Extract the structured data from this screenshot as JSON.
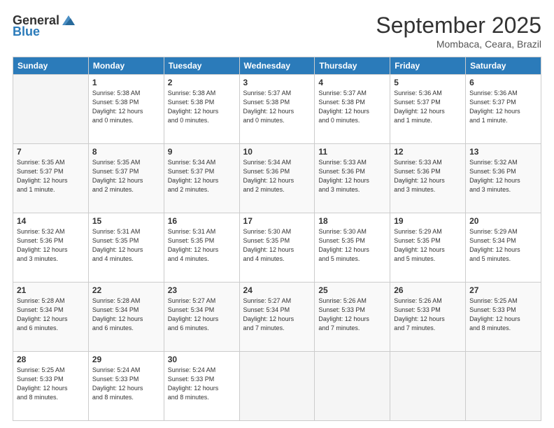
{
  "header": {
    "logo_general": "General",
    "logo_blue": "Blue",
    "month_year": "September 2025",
    "location": "Mombaca, Ceara, Brazil"
  },
  "weekdays": [
    "Sunday",
    "Monday",
    "Tuesday",
    "Wednesday",
    "Thursday",
    "Friday",
    "Saturday"
  ],
  "weeks": [
    [
      {
        "day": "",
        "content": ""
      },
      {
        "day": "1",
        "content": "Sunrise: 5:38 AM\nSunset: 5:38 PM\nDaylight: 12 hours\nand 0 minutes."
      },
      {
        "day": "2",
        "content": "Sunrise: 5:38 AM\nSunset: 5:38 PM\nDaylight: 12 hours\nand 0 minutes."
      },
      {
        "day": "3",
        "content": "Sunrise: 5:37 AM\nSunset: 5:38 PM\nDaylight: 12 hours\nand 0 minutes."
      },
      {
        "day": "4",
        "content": "Sunrise: 5:37 AM\nSunset: 5:38 PM\nDaylight: 12 hours\nand 0 minutes."
      },
      {
        "day": "5",
        "content": "Sunrise: 5:36 AM\nSunset: 5:37 PM\nDaylight: 12 hours\nand 1 minute."
      },
      {
        "day": "6",
        "content": "Sunrise: 5:36 AM\nSunset: 5:37 PM\nDaylight: 12 hours\nand 1 minute."
      }
    ],
    [
      {
        "day": "7",
        "content": "Sunrise: 5:35 AM\nSunset: 5:37 PM\nDaylight: 12 hours\nand 1 minute."
      },
      {
        "day": "8",
        "content": "Sunrise: 5:35 AM\nSunset: 5:37 PM\nDaylight: 12 hours\nand 2 minutes."
      },
      {
        "day": "9",
        "content": "Sunrise: 5:34 AM\nSunset: 5:37 PM\nDaylight: 12 hours\nand 2 minutes."
      },
      {
        "day": "10",
        "content": "Sunrise: 5:34 AM\nSunset: 5:36 PM\nDaylight: 12 hours\nand 2 minutes."
      },
      {
        "day": "11",
        "content": "Sunrise: 5:33 AM\nSunset: 5:36 PM\nDaylight: 12 hours\nand 3 minutes."
      },
      {
        "day": "12",
        "content": "Sunrise: 5:33 AM\nSunset: 5:36 PM\nDaylight: 12 hours\nand 3 minutes."
      },
      {
        "day": "13",
        "content": "Sunrise: 5:32 AM\nSunset: 5:36 PM\nDaylight: 12 hours\nand 3 minutes."
      }
    ],
    [
      {
        "day": "14",
        "content": "Sunrise: 5:32 AM\nSunset: 5:36 PM\nDaylight: 12 hours\nand 3 minutes."
      },
      {
        "day": "15",
        "content": "Sunrise: 5:31 AM\nSunset: 5:35 PM\nDaylight: 12 hours\nand 4 minutes."
      },
      {
        "day": "16",
        "content": "Sunrise: 5:31 AM\nSunset: 5:35 PM\nDaylight: 12 hours\nand 4 minutes."
      },
      {
        "day": "17",
        "content": "Sunrise: 5:30 AM\nSunset: 5:35 PM\nDaylight: 12 hours\nand 4 minutes."
      },
      {
        "day": "18",
        "content": "Sunrise: 5:30 AM\nSunset: 5:35 PM\nDaylight: 12 hours\nand 5 minutes."
      },
      {
        "day": "19",
        "content": "Sunrise: 5:29 AM\nSunset: 5:35 PM\nDaylight: 12 hours\nand 5 minutes."
      },
      {
        "day": "20",
        "content": "Sunrise: 5:29 AM\nSunset: 5:34 PM\nDaylight: 12 hours\nand 5 minutes."
      }
    ],
    [
      {
        "day": "21",
        "content": "Sunrise: 5:28 AM\nSunset: 5:34 PM\nDaylight: 12 hours\nand 6 minutes."
      },
      {
        "day": "22",
        "content": "Sunrise: 5:28 AM\nSunset: 5:34 PM\nDaylight: 12 hours\nand 6 minutes."
      },
      {
        "day": "23",
        "content": "Sunrise: 5:27 AM\nSunset: 5:34 PM\nDaylight: 12 hours\nand 6 minutes."
      },
      {
        "day": "24",
        "content": "Sunrise: 5:27 AM\nSunset: 5:34 PM\nDaylight: 12 hours\nand 7 minutes."
      },
      {
        "day": "25",
        "content": "Sunrise: 5:26 AM\nSunset: 5:33 PM\nDaylight: 12 hours\nand 7 minutes."
      },
      {
        "day": "26",
        "content": "Sunrise: 5:26 AM\nSunset: 5:33 PM\nDaylight: 12 hours\nand 7 minutes."
      },
      {
        "day": "27",
        "content": "Sunrise: 5:25 AM\nSunset: 5:33 PM\nDaylight: 12 hours\nand 8 minutes."
      }
    ],
    [
      {
        "day": "28",
        "content": "Sunrise: 5:25 AM\nSunset: 5:33 PM\nDaylight: 12 hours\nand 8 minutes."
      },
      {
        "day": "29",
        "content": "Sunrise: 5:24 AM\nSunset: 5:33 PM\nDaylight: 12 hours\nand 8 minutes."
      },
      {
        "day": "30",
        "content": "Sunrise: 5:24 AM\nSunset: 5:33 PM\nDaylight: 12 hours\nand 8 minutes."
      },
      {
        "day": "",
        "content": ""
      },
      {
        "day": "",
        "content": ""
      },
      {
        "day": "",
        "content": ""
      },
      {
        "day": "",
        "content": ""
      }
    ]
  ]
}
